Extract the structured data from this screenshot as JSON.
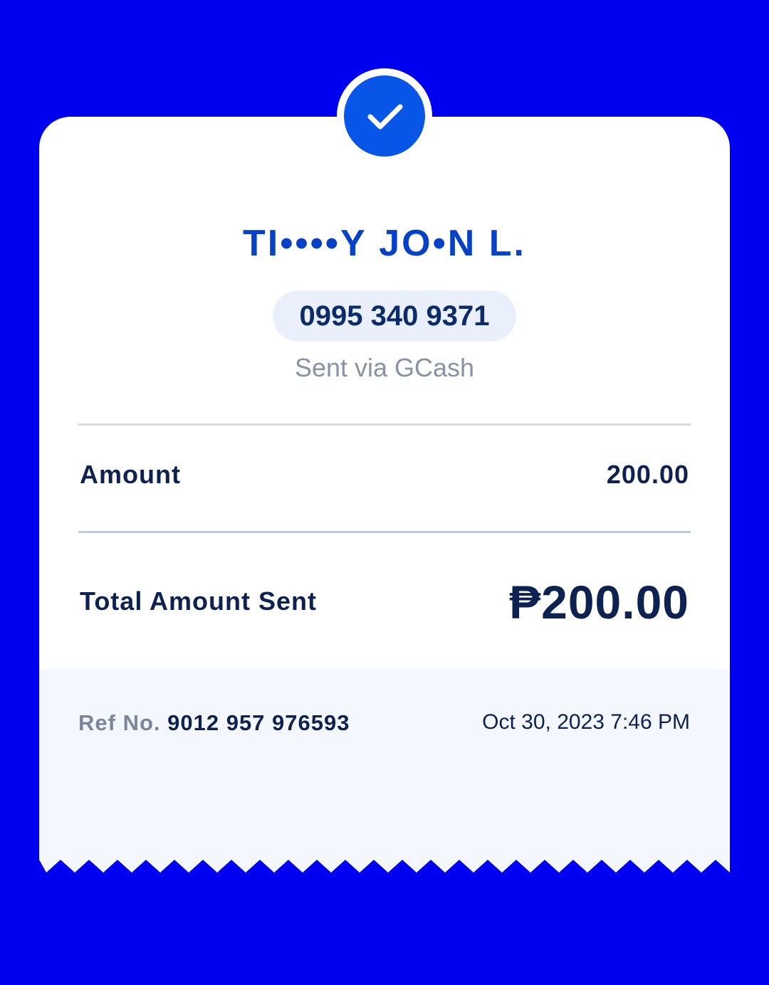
{
  "colors": {
    "background": "#0000f0",
    "accent": "#0756e8",
    "name_text": "#0741c8",
    "dark_text": "#0d2250",
    "muted_text": "#8892a3",
    "footer_bg": "#f4f7fd"
  },
  "status": {
    "icon": "checkmark-icon"
  },
  "recipient": {
    "name": "TI••••Y JO•N L.",
    "phone": "0995 340 9371",
    "sent_via": "Sent via GCash"
  },
  "details": {
    "amount_label": "Amount",
    "amount_value": "200.00",
    "total_label": "Total Amount Sent",
    "total_value": "₱200.00"
  },
  "footer": {
    "ref_label": "Ref No.",
    "ref_number": "9012 957 976593",
    "timestamp": "Oct 30, 2023 7:46 PM"
  }
}
